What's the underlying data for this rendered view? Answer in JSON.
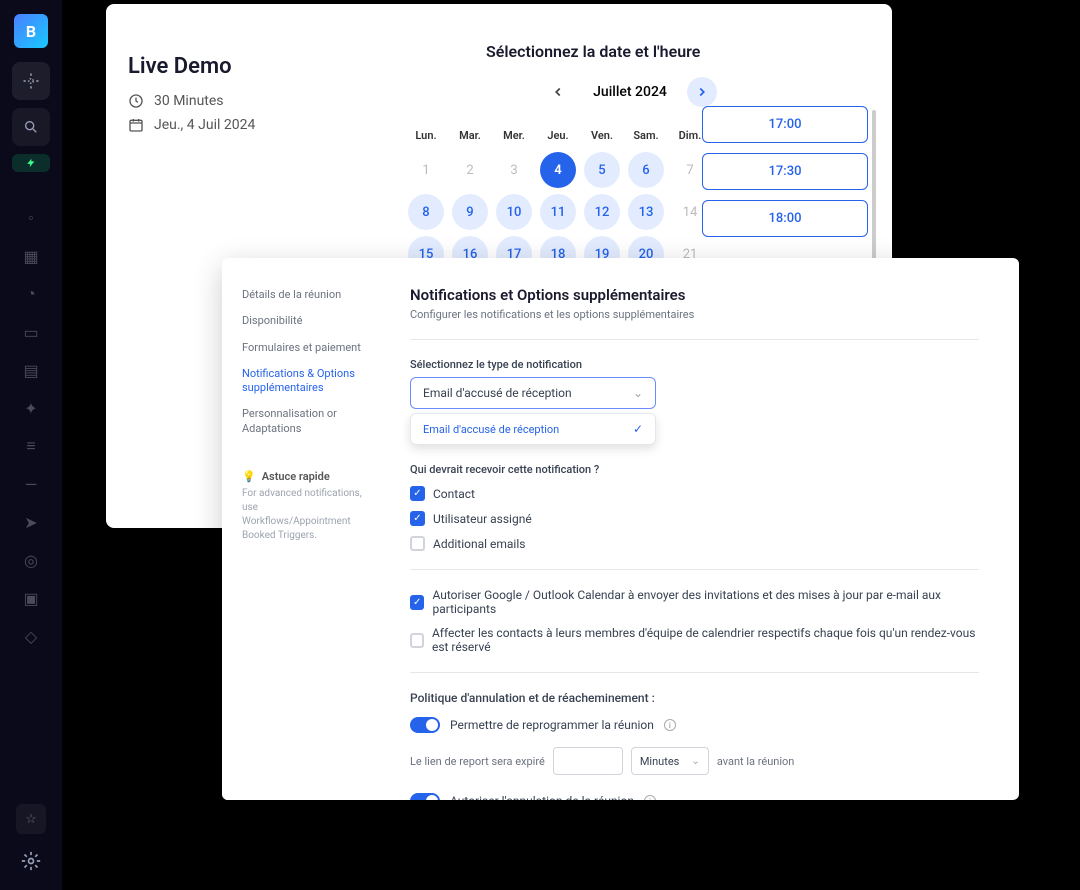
{
  "sidebar": {
    "logo": "B"
  },
  "calendar": {
    "title": "Live Demo",
    "duration": "30 Minutes",
    "date_display": "Jeu., 4 Juil 2024",
    "select_prompt": "Sélectionnez la date et l'heure",
    "month_label": "Juillet 2024",
    "weekdays": [
      "Lun.",
      "Mar.",
      "Mer.",
      "Jeu.",
      "Ven.",
      "Sam.",
      "Dim."
    ],
    "days": [
      {
        "n": "1",
        "state": "disabled"
      },
      {
        "n": "2",
        "state": "disabled"
      },
      {
        "n": "3",
        "state": "disabled"
      },
      {
        "n": "4",
        "state": "selected"
      },
      {
        "n": "5",
        "state": "avail"
      },
      {
        "n": "6",
        "state": "avail"
      },
      {
        "n": "7",
        "state": "disabled"
      },
      {
        "n": "8",
        "state": "avail"
      },
      {
        "n": "9",
        "state": "avail"
      },
      {
        "n": "10",
        "state": "avail"
      },
      {
        "n": "11",
        "state": "avail"
      },
      {
        "n": "12",
        "state": "avail"
      },
      {
        "n": "13",
        "state": "avail"
      },
      {
        "n": "14",
        "state": "disabled"
      },
      {
        "n": "15",
        "state": "avail"
      },
      {
        "n": "16",
        "state": "avail"
      },
      {
        "n": "17",
        "state": "avail"
      },
      {
        "n": "18",
        "state": "avail"
      },
      {
        "n": "19",
        "state": "avail"
      },
      {
        "n": "20",
        "state": "avail"
      },
      {
        "n": "21",
        "state": "disabled"
      }
    ],
    "timeslots": [
      "17:00",
      "17:30",
      "18:00"
    ]
  },
  "settings": {
    "nav": {
      "details": "Détails de la réunion",
      "availability": "Disponibilité",
      "forms": "Formulaires et paiement",
      "notifications": "Notifications & Options supplémentaires",
      "customization": "Personnalisation or Adaptations"
    },
    "tip_title": "Astuce rapide",
    "tip_text": "For advanced notifications, use Workflows/Appointment Booked Triggers.",
    "panel_title": "Notifications et Options supplémentaires",
    "panel_sub": "Configurer les notifications et les options supplémentaires",
    "notif_type_label": "Sélectionnez le type de notification",
    "notif_type_value": "Email d'accusé de réception",
    "dropdown_option": "Email d'accusé de réception",
    "who_label": "Qui devrait recevoir cette notification ?",
    "who_contact": "Contact",
    "who_user": "Utilisateur assigné",
    "who_additional": "Additional emails",
    "allow_calendar": "Autoriser Google / Outlook Calendar à envoyer des invitations et des mises à jour par e-mail aux participants",
    "assign_contacts": "Affecter les contacts à leurs membres d'équipe de calendrier respectifs chaque fois qu'un rendez-vous est réservé",
    "policy_title": "Politique d'annulation et de réacheminement :",
    "reschedule": "Permettre de reprogrammer la réunion",
    "expire_prefix": "Le lien de report sera expiré",
    "expire_unit": "Minutes",
    "expire_suffix": "avant la réunion",
    "allow_cancel": "Autoriser l'annulation de la réunion"
  }
}
